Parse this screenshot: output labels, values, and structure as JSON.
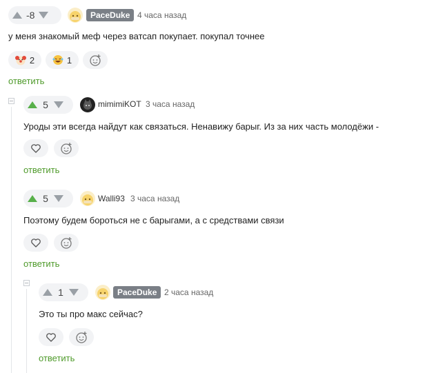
{
  "comments": [
    {
      "rating": "-8",
      "author": "PaceDuke",
      "time": "4 часа назад",
      "text": "у меня знакомый меф через ватсап покупает. покупал точнее",
      "reactions": [
        {
          "icon": "clown-face-icon",
          "count": "2"
        },
        {
          "icon": "laughing-face-icon",
          "count": "1"
        }
      ],
      "reply_label": "ответить"
    },
    {
      "rating": "5",
      "author": "mimimiKOT",
      "time": "3 часа назад",
      "text": "Уроды эти всегда найдут как связаться. Ненавижу барыг. Из за них часть молодёжи -",
      "reply_label": "ответить"
    },
    {
      "rating": "5",
      "author": "Walli93",
      "time": "3 часа назад",
      "text": "Поэтому будем бороться не с барыгами, а с средствами связи",
      "reply_label": "ответить"
    },
    {
      "rating": "1",
      "author": "PaceDuke",
      "time": "2 часа назад",
      "text": "Это ты про макс сейчас?",
      "reply_label": "ответить"
    }
  ],
  "colors": {
    "accent_green": "#4e9a2a",
    "vote_up_active": "#58b04a",
    "vote_idle": "#9aa0a6",
    "badge_bg": "#7a7f86",
    "pill_bg": "#f2f3f5"
  }
}
